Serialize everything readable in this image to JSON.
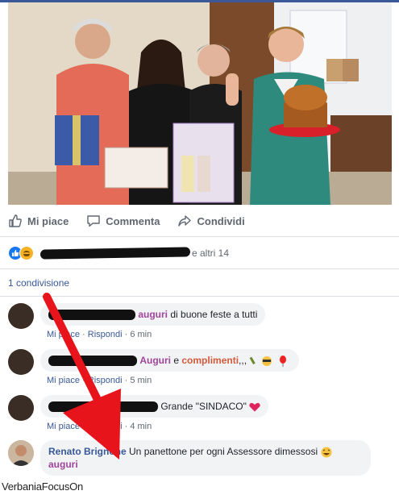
{
  "post_actions": {
    "like_label": "Mi piace",
    "comment_label": "Commenta",
    "share_label": "Condividi"
  },
  "reactions": {
    "others_text": "e altri 14"
  },
  "shares_text": "1 condivisione",
  "comments": [
    {
      "text_parts": [
        "auguri",
        " di buone feste a tutti"
      ],
      "like": "Mi piace",
      "reply": "Rispondi",
      "time": "6 min"
    },
    {
      "text_parts": [
        "Auguri",
        " e ",
        "complimenti",
        ",,,"
      ],
      "like": "Mi piace",
      "reply": "Rispondi",
      "time": "5 min"
    },
    {
      "text_parts": [
        "Grande \"SINDACO\""
      ],
      "like": "Mi piace",
      "reply": "Rispondi",
      "time": "4 min"
    },
    {
      "author": "Renato Brignone",
      "text_line1": "Un panettone per ogni Assessore dimessosi",
      "text_line2": "auguri"
    }
  ],
  "watermark": "VerbaniaFocusOn",
  "colors": {
    "link": "#385898",
    "keyword": "#a0459b",
    "arrow": "#e8141b"
  }
}
